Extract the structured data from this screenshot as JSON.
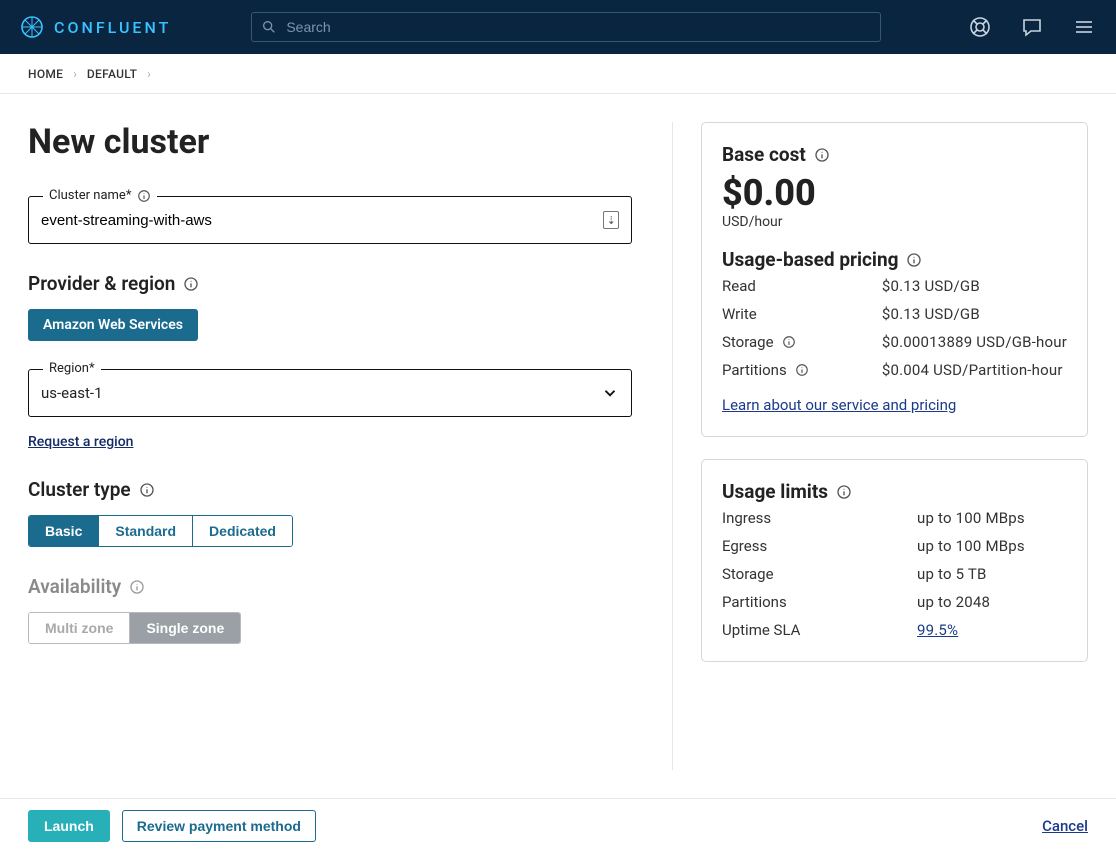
{
  "brand": "CONFLUENT",
  "search": {
    "placeholder": "Search"
  },
  "breadcrumb": {
    "home": "HOME",
    "env": "DEFAULT"
  },
  "title": "New cluster",
  "cluster_name": {
    "label": "Cluster name*",
    "value": "event-streaming-with-aws"
  },
  "provider_region": {
    "heading": "Provider & region",
    "provider_btn": "Amazon Web Services",
    "region_label": "Region*",
    "region_value": "us-east-1",
    "request_link": "Request a region"
  },
  "cluster_type": {
    "heading": "Cluster type",
    "options": [
      "Basic",
      "Standard",
      "Dedicated"
    ],
    "active": 0
  },
  "availability": {
    "heading": "Availability",
    "options": [
      "Multi zone",
      "Single zone"
    ],
    "active": 1
  },
  "pricing": {
    "base_heading": "Base cost",
    "price": "$0.00",
    "price_sub": "USD/hour",
    "usage_heading": "Usage-based pricing",
    "rows": [
      {
        "k": "Read",
        "v": "$0.13 USD/GB",
        "info": false
      },
      {
        "k": "Write",
        "v": "$0.13 USD/GB",
        "info": false
      },
      {
        "k": "Storage",
        "v": "$0.00013889 USD/GB-hour",
        "info": true
      },
      {
        "k": "Partitions",
        "v": "$0.004 USD/Partition-hour",
        "info": true
      }
    ],
    "learn_link": "Learn about our service and pricing"
  },
  "limits": {
    "heading": "Usage limits",
    "rows": [
      {
        "k": "Ingress",
        "v": "up to 100 MBps"
      },
      {
        "k": "Egress",
        "v": "up to 100 MBps"
      },
      {
        "k": "Storage",
        "v": "up to 5 TB"
      },
      {
        "k": "Partitions",
        "v": "up to 2048"
      },
      {
        "k": "Uptime SLA",
        "v": "99.5%",
        "link": true
      }
    ]
  },
  "footer": {
    "launch": "Launch",
    "review": "Review payment method",
    "cancel": "Cancel"
  }
}
